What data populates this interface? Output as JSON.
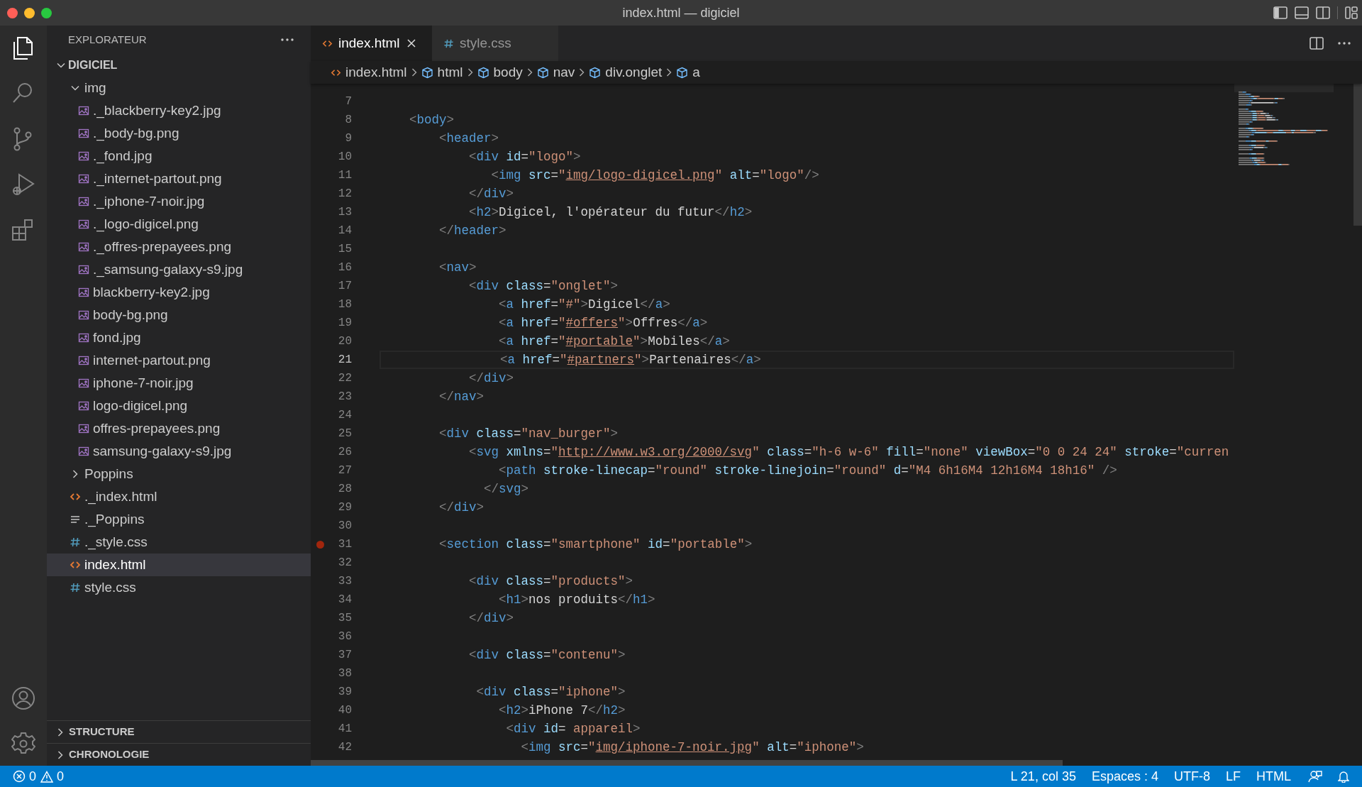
{
  "window": {
    "title": "index.html — digiciel"
  },
  "activity_bar": {
    "items": [
      {
        "kind": "explorer",
        "selected": true
      },
      {
        "kind": "search",
        "selected": false
      },
      {
        "kind": "scm",
        "selected": false
      },
      {
        "kind": "debug",
        "selected": false
      },
      {
        "kind": "extensions",
        "selected": false
      }
    ]
  },
  "sidebar": {
    "title": "EXPLORATEUR",
    "root": {
      "name": "DIGICIEL",
      "expanded": true,
      "children": [
        {
          "name": "img",
          "kind": "folder",
          "expanded": true,
          "selected": false,
          "children": [
            {
              "name": "._blackberry-key2.jpg",
              "kind": "image",
              "selected": false
            },
            {
              "name": "._body-bg.png",
              "kind": "image",
              "selected": false
            },
            {
              "name": "._fond.jpg",
              "kind": "image",
              "selected": false
            },
            {
              "name": "._internet-partout.png",
              "kind": "image",
              "selected": false
            },
            {
              "name": "._iphone-7-noir.jpg",
              "kind": "image",
              "selected": false
            },
            {
              "name": "._logo-digicel.png",
              "kind": "image",
              "selected": false
            },
            {
              "name": "._offres-prepayees.png",
              "kind": "image",
              "selected": false
            },
            {
              "name": "._samsung-galaxy-s9.jpg",
              "kind": "image",
              "selected": false
            },
            {
              "name": "blackberry-key2.jpg",
              "kind": "image",
              "selected": false
            },
            {
              "name": "body-bg.png",
              "kind": "image",
              "selected": false
            },
            {
              "name": "fond.jpg",
              "kind": "image",
              "selected": false
            },
            {
              "name": "internet-partout.png",
              "kind": "image",
              "selected": false
            },
            {
              "name": "iphone-7-noir.jpg",
              "kind": "image",
              "selected": false
            },
            {
              "name": "logo-digicel.png",
              "kind": "image",
              "selected": false
            },
            {
              "name": "offres-prepayees.png",
              "kind": "image",
              "selected": false
            },
            {
              "name": "samsung-galaxy-s9.jpg",
              "kind": "image",
              "selected": false
            }
          ]
        },
        {
          "name": "Poppins",
          "kind": "folder",
          "expanded": false,
          "selected": false
        },
        {
          "name": "._index.html",
          "kind": "html",
          "selected": false
        },
        {
          "name": "._Poppins",
          "kind": "text",
          "selected": false
        },
        {
          "name": "._style.css",
          "kind": "css",
          "selected": false
        },
        {
          "name": "index.html",
          "kind": "html",
          "selected": true
        },
        {
          "name": "style.css",
          "kind": "css",
          "selected": false
        }
      ]
    },
    "panels": [
      {
        "title": "STRUCTURE",
        "expanded": false
      },
      {
        "title": "CHRONOLOGIE",
        "expanded": false
      }
    ]
  },
  "tabs": [
    {
      "label": "index.html",
      "kind": "html",
      "selected": true
    },
    {
      "label": "style.css",
      "kind": "css",
      "selected": false
    }
  ],
  "breadcrumbs": [
    {
      "label": "index.html",
      "kind": "html"
    },
    {
      "label": "html",
      "kind": "element"
    },
    {
      "label": "body",
      "kind": "element"
    },
    {
      "label": "nav",
      "kind": "element"
    },
    {
      "label": "div.onglet",
      "kind": "element"
    },
    {
      "label": "a",
      "kind": "element"
    }
  ],
  "code_lines": [
    {
      "n": "7",
      "current": false,
      "breakpoint": false
    },
    {
      "n": "8",
      "current": false,
      "breakpoint": false,
      "tokens": [
        {
          "p": "    <"
        },
        {
          "tag": "body"
        },
        {
          "p": ">"
        }
      ]
    },
    {
      "n": "9",
      "current": false,
      "breakpoint": false,
      "tokens": [
        {
          "p": "        <"
        },
        {
          "tag": "header"
        },
        {
          "p": ">"
        }
      ]
    },
    {
      "n": "10",
      "current": false,
      "breakpoint": false,
      "tokens": [
        {
          "p": "            <"
        },
        {
          "tag": "div"
        },
        {
          "attr": " id"
        },
        {
          "text": "="
        },
        {
          "str": "\"logo\""
        },
        {
          "p": ">"
        }
      ]
    },
    {
      "n": "11",
      "current": false,
      "breakpoint": false,
      "tokens": [
        {
          "p": "               <"
        },
        {
          "tag": "img"
        },
        {
          "attr": " src"
        },
        {
          "text": "="
        },
        {
          "str": "\""
        },
        {
          "link": "img/logo-digicel.png"
        },
        {
          "str": "\""
        },
        {
          "attr": " alt"
        },
        {
          "text": "="
        },
        {
          "str": "\"logo\""
        },
        {
          "p": "/>"
        }
      ]
    },
    {
      "n": "12",
      "current": false,
      "breakpoint": false,
      "tokens": [
        {
          "p": "            </"
        },
        {
          "tag": "div"
        },
        {
          "p": ">"
        }
      ]
    },
    {
      "n": "13",
      "current": false,
      "breakpoint": false,
      "tokens": [
        {
          "p": "            <"
        },
        {
          "tag": "h2"
        },
        {
          "p": ">"
        },
        {
          "text": "Digicel, l'opérateur du futur"
        },
        {
          "p": "</"
        },
        {
          "tag": "h2"
        },
        {
          "p": ">"
        }
      ]
    },
    {
      "n": "14",
      "current": false,
      "breakpoint": false,
      "tokens": [
        {
          "p": "        </"
        },
        {
          "tag": "header"
        },
        {
          "p": ">"
        }
      ]
    },
    {
      "n": "15",
      "current": false,
      "breakpoint": false
    },
    {
      "n": "16",
      "current": false,
      "breakpoint": false,
      "tokens": [
        {
          "p": "        <"
        },
        {
          "tag": "nav"
        },
        {
          "p": ">"
        }
      ]
    },
    {
      "n": "17",
      "current": false,
      "breakpoint": false,
      "tokens": [
        {
          "p": "            <"
        },
        {
          "tag": "div"
        },
        {
          "attr": " class"
        },
        {
          "text": "="
        },
        {
          "str": "\"onglet\""
        },
        {
          "p": ">"
        }
      ]
    },
    {
      "n": "18",
      "current": false,
      "breakpoint": false,
      "tokens": [
        {
          "p": "                <"
        },
        {
          "tag": "a"
        },
        {
          "attr": " href"
        },
        {
          "text": "="
        },
        {
          "str": "\"#\""
        },
        {
          "p": ">"
        },
        {
          "text": "Digicel"
        },
        {
          "p": "</"
        },
        {
          "tag": "a"
        },
        {
          "p": ">"
        }
      ]
    },
    {
      "n": "19",
      "current": false,
      "breakpoint": false,
      "tokens": [
        {
          "p": "                <"
        },
        {
          "tag": "a"
        },
        {
          "attr": " href"
        },
        {
          "text": "="
        },
        {
          "str": "\""
        },
        {
          "link": "#offers"
        },
        {
          "str": "\""
        },
        {
          "p": ">"
        },
        {
          "text": "Offres"
        },
        {
          "p": "</"
        },
        {
          "tag": "a"
        },
        {
          "p": ">"
        }
      ]
    },
    {
      "n": "20",
      "current": false,
      "breakpoint": false,
      "tokens": [
        {
          "p": "                <"
        },
        {
          "tag": "a"
        },
        {
          "attr": " href"
        },
        {
          "text": "="
        },
        {
          "str": "\""
        },
        {
          "link": "#portable"
        },
        {
          "str": "\""
        },
        {
          "p": ">"
        },
        {
          "text": "Mobiles"
        },
        {
          "p": "</"
        },
        {
          "tag": "a"
        },
        {
          "p": ">"
        }
      ]
    },
    {
      "n": "21",
      "current": true,
      "breakpoint": false,
      "tokens": [
        {
          "p": "                <"
        },
        {
          "tag": "a"
        },
        {
          "attr": " href"
        },
        {
          "text": "="
        },
        {
          "str": "\""
        },
        {
          "link": "#partners"
        },
        {
          "str": "\""
        },
        {
          "p": ">"
        },
        {
          "text": "Partenaires"
        },
        {
          "p": "</"
        },
        {
          "tag": "a"
        },
        {
          "p": ">"
        }
      ]
    },
    {
      "n": "22",
      "current": false,
      "breakpoint": false,
      "tokens": [
        {
          "p": "            </"
        },
        {
          "tag": "div"
        },
        {
          "p": ">"
        }
      ]
    },
    {
      "n": "23",
      "current": false,
      "breakpoint": false,
      "tokens": [
        {
          "p": "        </"
        },
        {
          "tag": "nav"
        },
        {
          "p": ">"
        }
      ]
    },
    {
      "n": "24",
      "current": false,
      "breakpoint": false
    },
    {
      "n": "25",
      "current": false,
      "breakpoint": false,
      "tokens": [
        {
          "p": "        <"
        },
        {
          "tag": "div"
        },
        {
          "attr": " class"
        },
        {
          "text": "="
        },
        {
          "str": "\"nav_burger\""
        },
        {
          "p": ">"
        }
      ]
    },
    {
      "n": "26",
      "current": false,
      "breakpoint": false,
      "tokens": [
        {
          "p": "            <"
        },
        {
          "tag": "svg"
        },
        {
          "attr": " xmlns"
        },
        {
          "text": "="
        },
        {
          "str": "\""
        },
        {
          "link": "http://www.w3.org/2000/svg"
        },
        {
          "str": "\""
        },
        {
          "attr": " class"
        },
        {
          "text": "="
        },
        {
          "str": "\"h-6 w-6\""
        },
        {
          "attr": " fill"
        },
        {
          "text": "="
        },
        {
          "str": "\"none\""
        },
        {
          "attr": " viewBox"
        },
        {
          "text": "="
        },
        {
          "str": "\"0 0 24 24\""
        },
        {
          "attr": " stroke"
        },
        {
          "text": "="
        },
        {
          "str": "\"curren"
        }
      ]
    },
    {
      "n": "27",
      "current": false,
      "breakpoint": false,
      "tokens": [
        {
          "p": "                <"
        },
        {
          "tag": "path"
        },
        {
          "attr": " stroke-linecap"
        },
        {
          "text": "="
        },
        {
          "str": "\"round\""
        },
        {
          "attr": " stroke-linejoin"
        },
        {
          "text": "="
        },
        {
          "str": "\"round\""
        },
        {
          "attr": " d"
        },
        {
          "text": "="
        },
        {
          "str": "\"M4 6h16M4 12h16M4 18h16\""
        },
        {
          "p": " />"
        }
      ]
    },
    {
      "n": "28",
      "current": false,
      "breakpoint": false,
      "tokens": [
        {
          "p": "              </"
        },
        {
          "tag": "svg"
        },
        {
          "p": ">"
        }
      ]
    },
    {
      "n": "29",
      "current": false,
      "breakpoint": false,
      "tokens": [
        {
          "p": "        </"
        },
        {
          "tag": "div"
        },
        {
          "p": ">"
        }
      ]
    },
    {
      "n": "30",
      "current": false,
      "breakpoint": false
    },
    {
      "n": "31",
      "current": false,
      "breakpoint": true,
      "tokens": [
        {
          "p": "        <"
        },
        {
          "tag": "section"
        },
        {
          "attr": " class"
        },
        {
          "text": "="
        },
        {
          "str": "\"smartphone\""
        },
        {
          "attr": " id"
        },
        {
          "text": "="
        },
        {
          "str": "\"portable\""
        },
        {
          "p": ">"
        }
      ]
    },
    {
      "n": "32",
      "current": false,
      "breakpoint": false
    },
    {
      "n": "33",
      "current": false,
      "breakpoint": false,
      "tokens": [
        {
          "p": "            <"
        },
        {
          "tag": "div"
        },
        {
          "attr": " class"
        },
        {
          "text": "="
        },
        {
          "str": "\"products\""
        },
        {
          "p": ">"
        }
      ]
    },
    {
      "n": "34",
      "current": false,
      "breakpoint": false,
      "tokens": [
        {
          "p": "                <"
        },
        {
          "tag": "h1"
        },
        {
          "p": ">"
        },
        {
          "text": "nos produits"
        },
        {
          "p": "</"
        },
        {
          "tag": "h1"
        },
        {
          "p": ">"
        }
      ]
    },
    {
      "n": "35",
      "current": false,
      "breakpoint": false,
      "tokens": [
        {
          "p": "            </"
        },
        {
          "tag": "div"
        },
        {
          "p": ">"
        }
      ]
    },
    {
      "n": "36",
      "current": false,
      "breakpoint": false
    },
    {
      "n": "37",
      "current": false,
      "breakpoint": false,
      "tokens": [
        {
          "p": "            <"
        },
        {
          "tag": "div"
        },
        {
          "attr": " class"
        },
        {
          "text": "="
        },
        {
          "str": "\"contenu\""
        },
        {
          "p": ">"
        }
      ]
    },
    {
      "n": "38",
      "current": false,
      "breakpoint": false
    },
    {
      "n": "39",
      "current": false,
      "breakpoint": false,
      "tokens": [
        {
          "p": "             <"
        },
        {
          "tag": "div"
        },
        {
          "attr": " class"
        },
        {
          "text": "="
        },
        {
          "str": "\"iphone\""
        },
        {
          "p": ">"
        }
      ]
    },
    {
      "n": "40",
      "current": false,
      "breakpoint": false,
      "tokens": [
        {
          "p": "                <"
        },
        {
          "tag": "h2"
        },
        {
          "p": ">"
        },
        {
          "text": "iPhone 7"
        },
        {
          "p": "</"
        },
        {
          "tag": "h2"
        },
        {
          "p": ">"
        }
      ]
    },
    {
      "n": "41",
      "current": false,
      "breakpoint": false,
      "tokens": [
        {
          "p": "                 <"
        },
        {
          "tag": "div"
        },
        {
          "attr": " id"
        },
        {
          "text": "="
        },
        {
          "str": " appareil"
        },
        {
          "p": ">"
        }
      ]
    },
    {
      "n": "42",
      "current": false,
      "breakpoint": false,
      "tokens": [
        {
          "p": "                   <"
        },
        {
          "tag": "img"
        },
        {
          "attr": " src"
        },
        {
          "text": "="
        },
        {
          "str": "\""
        },
        {
          "link": "img/iphone-7-noir.jpg"
        },
        {
          "str": "\""
        },
        {
          "attr": " alt"
        },
        {
          "text": "="
        },
        {
          "str": "\"iphone\""
        },
        {
          "p": ">"
        }
      ]
    }
  ],
  "status_bar": {
    "errors": "0",
    "warnings": "0",
    "items": [
      "L 21, col 35",
      "Espaces : 4",
      "UTF-8",
      "LF",
      "HTML"
    ]
  }
}
